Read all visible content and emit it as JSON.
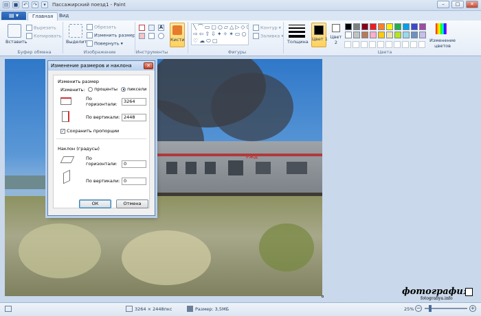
{
  "window": {
    "title": "Пассажирский поезд1 - Paint"
  },
  "tabs": [
    {
      "label": "Главная"
    },
    {
      "label": "Вид"
    }
  ],
  "ribbon": {
    "clipboard": {
      "paste": "Вставить",
      "cut": "Вырезать",
      "copy": "Копировать",
      "label": "Буфер обмена"
    },
    "image": {
      "select": "Выделить",
      "crop": "Обрезать",
      "resize": "Изменить размер",
      "rotate": "Повернуть",
      "label": "Изображение"
    },
    "tools": {
      "label": "Инструменты"
    },
    "brushes": {
      "label": "Кисти"
    },
    "shapes": {
      "outline": "Контур",
      "fill": "Заливка",
      "label": "Фигуры"
    },
    "size": {
      "label": "Толщина"
    },
    "colors": {
      "color1": "Цвет 1",
      "color2": "Цвет 2",
      "edit": "Изменение цветов",
      "label": "Цвета"
    },
    "palette": [
      "#000000",
      "#7f7f7f",
      "#880015",
      "#ed1c24",
      "#ff7f27",
      "#fff200",
      "#22b14c",
      "#00a2e8",
      "#3f48cc",
      "#a349a4",
      "#ffffff",
      "#c3c3c3",
      "#b97a57",
      "#ffaec9",
      "#ffc90e",
      "#efe4b0",
      "#b5e61d",
      "#99d9ea",
      "#7092be",
      "#c8bfe7"
    ]
  },
  "dialog": {
    "title": "Изменение размеров и наклона",
    "resize_section": "Изменить размер",
    "by_label": "Изменить:",
    "percent": "проценты",
    "pixels": "пиксели",
    "horizontal": "По горизонтали:",
    "vertical": "По вертикали:",
    "width": "3264",
    "height": "2448",
    "keep_ratio": "Сохранить пропорции",
    "skew_section": "Наклон (градусы)",
    "skew_h": "0",
    "skew_v": "0",
    "ok": "ОК",
    "cancel": "Отмена"
  },
  "image": {
    "train_marking": "РЖД"
  },
  "status": {
    "dimensions": "3264 × 2448пкс",
    "size": "Размер: 3,5МБ",
    "zoom": "25%"
  },
  "watermark": {
    "logo": "фотография",
    "site": "fotografiya.info"
  }
}
